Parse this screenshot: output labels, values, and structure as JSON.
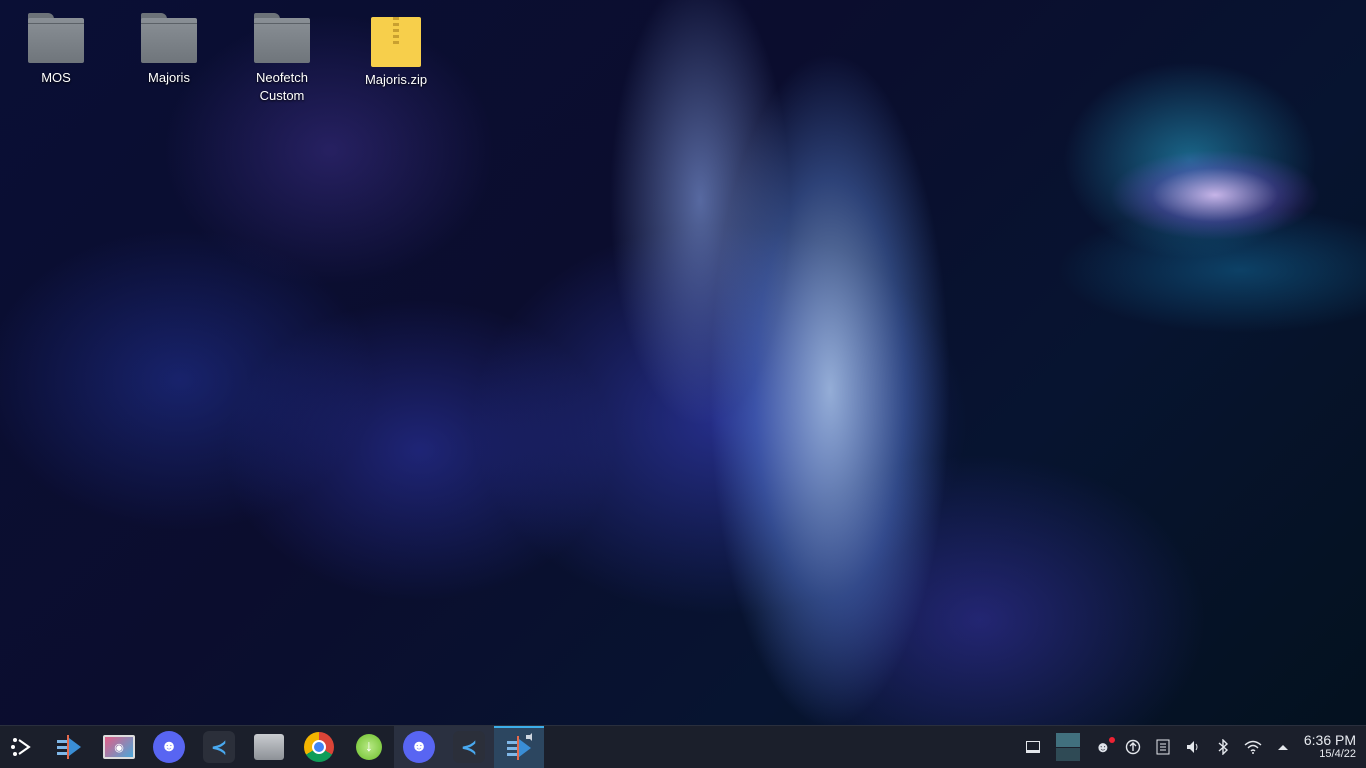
{
  "desktop": {
    "icons": [
      {
        "label": "MOS",
        "type": "folder"
      },
      {
        "label": "Majoris",
        "type": "folder"
      },
      {
        "label": "Neofetch Custom",
        "type": "folder"
      },
      {
        "label": "Majoris.zip",
        "type": "zip"
      }
    ]
  },
  "taskbar": {
    "launcher_icon": "app-launcher-icon",
    "items": [
      {
        "name": "steam-switch-icon",
        "active": false
      },
      {
        "name": "screenshot-monitor-icon",
        "active": false
      },
      {
        "name": "discord-icon",
        "active": false
      },
      {
        "name": "vscode-icon",
        "active": false
      },
      {
        "name": "file-manager-icon",
        "active": false
      },
      {
        "name": "chrome-icon",
        "active": false
      },
      {
        "name": "downloader-icon",
        "active": false
      },
      {
        "name": "discord-icon",
        "active": true
      },
      {
        "name": "vscode-icon",
        "active": true
      },
      {
        "name": "steam-switch-icon",
        "active": true
      }
    ],
    "tray": {
      "icons": [
        "show-desktop-icon",
        "discord-tray-icon",
        "update-icon",
        "clipboard-icon",
        "volume-icon",
        "bluetooth-icon",
        "wifi-icon",
        "expand-tray-icon"
      ],
      "clock": {
        "time": "6:36 PM",
        "date": "15/4/22"
      }
    }
  }
}
